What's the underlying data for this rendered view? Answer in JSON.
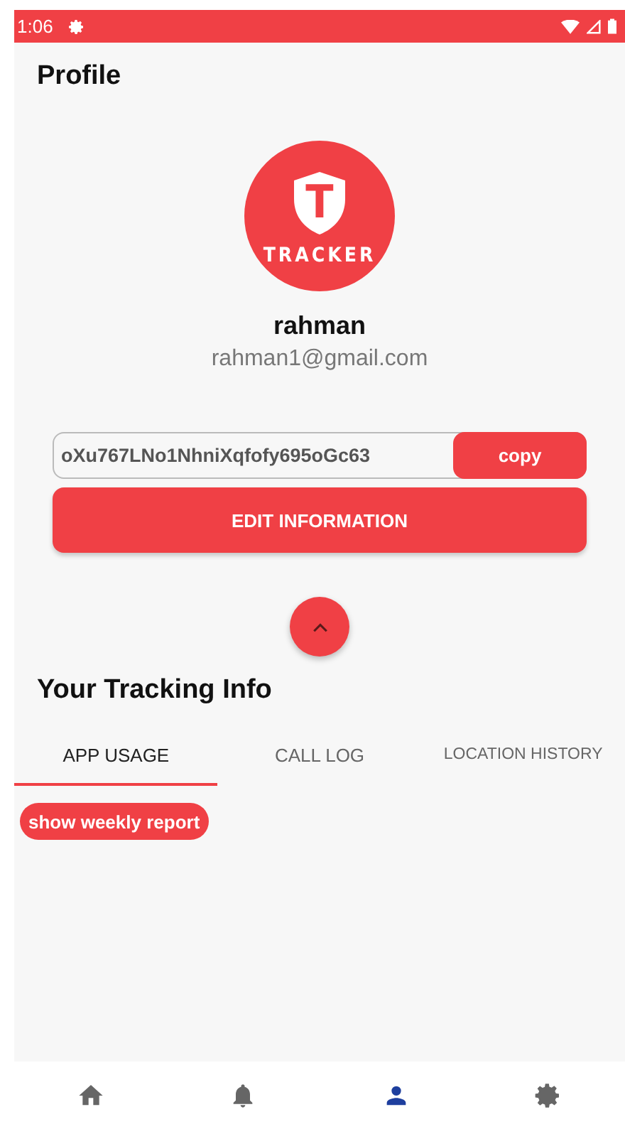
{
  "status_bar": {
    "time": "1:06"
  },
  "header": {
    "title": "Profile"
  },
  "profile": {
    "logo_letter": "T",
    "logo_text": "TRACKER",
    "name": "rahman",
    "email": "rahman1@gmail.com"
  },
  "code_field": {
    "value": "oXu767LNo1NhniXqfofy695oGc63",
    "button": "copy"
  },
  "edit_button": "EDIT INFORMATION",
  "tracking": {
    "title": "Your Tracking Info",
    "tabs": [
      {
        "label": "APP USAGE",
        "selected": true
      },
      {
        "label": "CALL LOG",
        "selected": false
      },
      {
        "label": "LOCATION HISTORY",
        "selected": false
      }
    ],
    "report_button": "show weekly report"
  },
  "bottom_nav": [
    {
      "kind": "home",
      "selected": false
    },
    {
      "kind": "bell",
      "selected": false
    },
    {
      "kind": "person",
      "selected": true
    },
    {
      "kind": "gear",
      "selected": false
    }
  ]
}
